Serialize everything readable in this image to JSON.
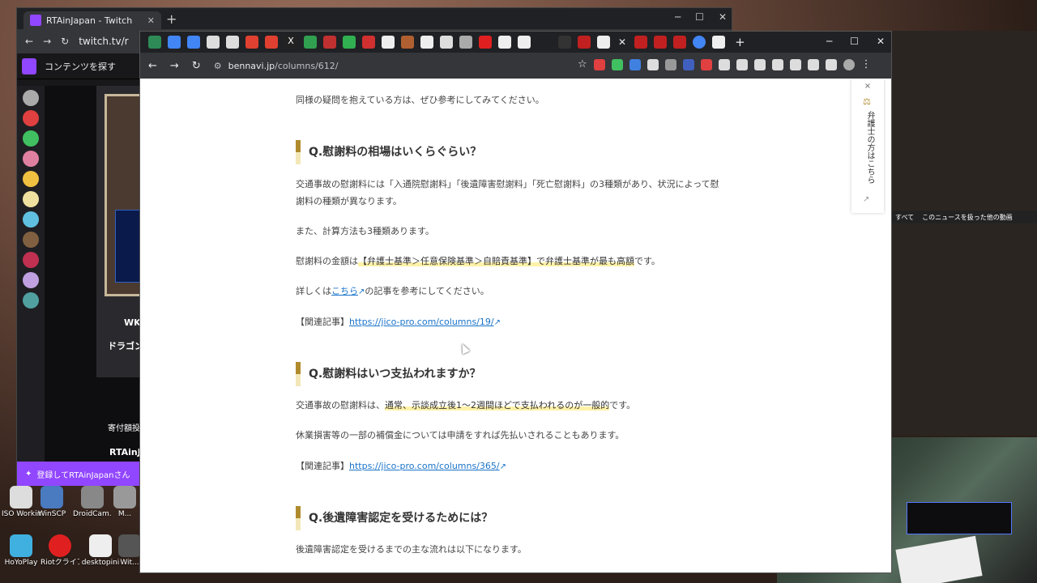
{
  "back_window": {
    "tab_title": "RTAinJapan - Twitch",
    "url": "twitch.tv/r",
    "twitch_search": "コンテンツを探す",
    "register_text": "登録してRTAinJapanさん",
    "channel_name": "RTAinJapan",
    "stream_title": "WKRN",
    "dragon_text": "ドラゴンク",
    "donate_text": "寄付額投票につ"
  },
  "front_window": {
    "url_domain": "bennavi.jp",
    "url_path": "/columns/612/"
  },
  "article": {
    "intro": "同様の疑問を抱えている方は、ぜひ参考にしてみてください。",
    "q1": {
      "heading": "Q.慰謝料の相場はいくらぐらい？",
      "p1": "交通事故の慰謝料には「入通院慰謝料」「後遺障害慰謝料」「死亡慰謝料」の3種類があり、状況によって慰謝料の種類が異なります。",
      "p2": "また、計算方法も3種類あります。",
      "p3_pre": "慰謝料の金額は",
      "p3_hl": "【弁護士基準＞任意保険基準＞自賠責基準】で弁護士基準が最も高額",
      "p3_post": "です。",
      "p4_pre": "詳しくは",
      "p4_link": "こちら",
      "p4_post": "の記事を参考にしてください。",
      "related_label": "【関連記事】",
      "related_link": "https://jico-pro.com/columns/19/"
    },
    "q2": {
      "heading": "Q.慰謝料はいつ支払われますか？",
      "p1_pre": "交通事故の慰謝料は、",
      "p1_hl": "通常、示談成立後1～2週間ほどで支払われるのが一般的",
      "p1_post": "です。",
      "p2": "休業損害等の一部の補償金については申請をすれば先払いされることもあります。",
      "related_label": "【関連記事】",
      "related_link": "https://jico-pro.com/columns/365/"
    },
    "q3": {
      "heading": "Q.後遺障害認定を受けるためには？",
      "p1": "後遺障害認定を受けるまでの主な流れは以下になります。"
    }
  },
  "side_widget": {
    "close": "×",
    "label": "弁護士の方はこちら"
  },
  "desktop": {
    "icons": [
      "ISO Workin...",
      "WinSCP",
      "DroidCam...",
      "M...",
      "HoYoPlay",
      "Riotクライアント",
      "desktopini",
      "Wit..."
    ]
  },
  "news": {
    "tab1": "すべて",
    "tab2": "このニュースを扱った他の動画"
  },
  "colors": {
    "twitch_purple": "#9146ff",
    "accent_gold": "#b08b2d",
    "link_blue": "#1a73c9",
    "highlight_yellow": "#fff2a8"
  }
}
